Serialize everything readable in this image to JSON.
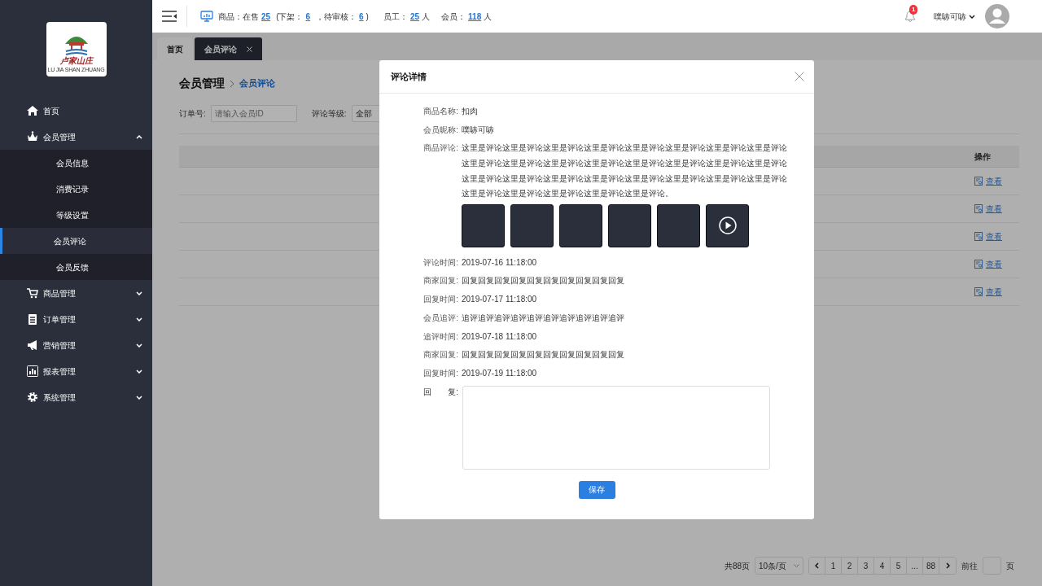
{
  "logo": {
    "title": "卢家山庄",
    "subtitle": "LU JIA SHAN ZHUANG"
  },
  "sidebar": {
    "items": [
      {
        "label": "首页",
        "selected": false
      },
      {
        "label": "会员管理",
        "selected": false,
        "expanded": true,
        "children": [
          {
            "label": "会员信息",
            "selected": false
          },
          {
            "label": "消费记录",
            "selected": false
          },
          {
            "label": "等级设置",
            "selected": false
          },
          {
            "label": "会员评论",
            "selected": true
          },
          {
            "label": "会员反馈",
            "selected": false
          }
        ]
      },
      {
        "label": "商品管理",
        "selected": false,
        "expanded": false
      },
      {
        "label": "订单管理",
        "selected": false,
        "expanded": false
      },
      {
        "label": "营销管理",
        "selected": false,
        "expanded": false
      },
      {
        "label": "报表管理",
        "selected": false,
        "expanded": false
      },
      {
        "label": "系统管理",
        "selected": false,
        "expanded": false
      }
    ]
  },
  "header": {
    "stats": [
      {
        "label": "商品：在售",
        "value": "25"
      },
      {
        "label": "(下架：",
        "value": "6"
      },
      {
        "label": "，待审核：",
        "value": "6",
        "suffix": ")"
      },
      {
        "label": "员工：",
        "value": "25",
        "suffix": "人"
      },
      {
        "label": "会员：",
        "value": "118",
        "suffix": "人"
      }
    ],
    "notification_count": "1",
    "user_name": "噗哧可哧"
  },
  "tabs": [
    {
      "label": "首页",
      "selected": false
    },
    {
      "label": "会员评论",
      "selected": true,
      "closable": true
    }
  ],
  "breadcrumb": [
    "会员管理",
    "会员评论"
  ],
  "filters": [
    {
      "label": "订单号:",
      "kind": "input",
      "placeholder": "请输入会员ID"
    },
    {
      "label": "评论等级:",
      "kind": "select",
      "value": "全部"
    }
  ],
  "table": {
    "columns": [
      "操作"
    ],
    "rows": [
      {
        "action": "查看"
      },
      {
        "action": "查看"
      },
      {
        "action": "查看"
      },
      {
        "action": "查看"
      },
      {
        "action": "查看"
      }
    ]
  },
  "pagination": {
    "total": "共88页",
    "page_size": "10条/页",
    "pages": [
      {
        "label": "1",
        "selected": false
      },
      {
        "label": "2",
        "selected": false
      },
      {
        "label": "3",
        "selected": false
      },
      {
        "label": "4",
        "selected": false
      },
      {
        "label": "5",
        "selected": false
      },
      {
        "label": "...",
        "selected": false
      },
      {
        "label": "88",
        "selected": false
      }
    ],
    "goto_label": "前往",
    "goto_suffix": "页"
  },
  "modal": {
    "title": "评论详情",
    "fields": [
      {
        "label": "商品名称:",
        "value": "扣肉"
      },
      {
        "label": "会员昵称:",
        "value": "噗哧可哧"
      },
      {
        "label": "商品评论:",
        "value": "这里是评论这里是评论这里是评论这里是评论这里是评论这里是评论这里是评论这里是评论这里是评论这里是评论这里是评论这里是评论这里是评论这里是评论这里是评论这里是评论这里是评论这里是评论这里是评论这里是评论这里是评论这里是评论这里是评论这里是评论这里是评论这里是评论这里是评论这里是评论这里是评论。",
        "media": [
          {
            "kind": "image"
          },
          {
            "kind": "image"
          },
          {
            "kind": "image"
          },
          {
            "kind": "image"
          },
          {
            "kind": "image"
          },
          {
            "kind": "video"
          }
        ]
      },
      {
        "label": "评论时间:",
        "value": "2019-07-16 11:18:00"
      },
      {
        "label": "商家回复:",
        "value": "回复回复回复回复回复回复回复回复回复回复"
      },
      {
        "label": "回复时间:",
        "value": "2019-07-17 11:18:00"
      },
      {
        "label": "会员追评:",
        "value": "追评追评追评追评追评追评追评追评追评追评"
      },
      {
        "label": "追评时间:",
        "value": "2019-07-18 11:18:00"
      },
      {
        "label": "商家回复:",
        "value": "回复回复回复回复回复回复回复回复回复回复"
      },
      {
        "label": "回复时间:",
        "value": "2019-07-19 11:18:00"
      }
    ],
    "reply_label": "回　　复:",
    "save_button": "保存"
  }
}
